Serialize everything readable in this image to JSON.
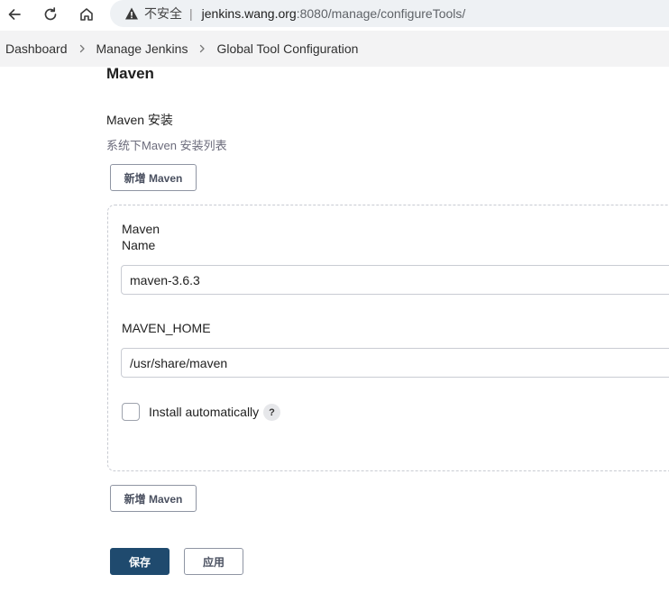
{
  "browser": {
    "security_label": "不安全",
    "separator": "|",
    "url_host": "jenkins.wang.org",
    "url_path": ":8080/manage/configureTools/"
  },
  "breadcrumb": {
    "items": [
      "Dashboard",
      "Manage Jenkins",
      "Global Tool Configuration"
    ]
  },
  "section": {
    "title": "Maven",
    "install_label": "Maven 安装",
    "install_desc": "系统下Maven 安装列表",
    "add_button": "新增 Maven"
  },
  "installation": {
    "header": "Maven",
    "name_label": "Name",
    "name_value": "maven-3.6.3",
    "home_label": "MAVEN_HOME",
    "home_value": "/usr/share/maven",
    "auto_install_label": "Install automatically",
    "auto_install_checked": false,
    "help": "?"
  },
  "footer": {
    "save_label": "保存",
    "apply_label": "应用"
  },
  "colors": {
    "save_button": "#1f4a6e",
    "breadcrumb_bg": "#f3f3f4",
    "omnibox_bg": "#eef1f4"
  }
}
